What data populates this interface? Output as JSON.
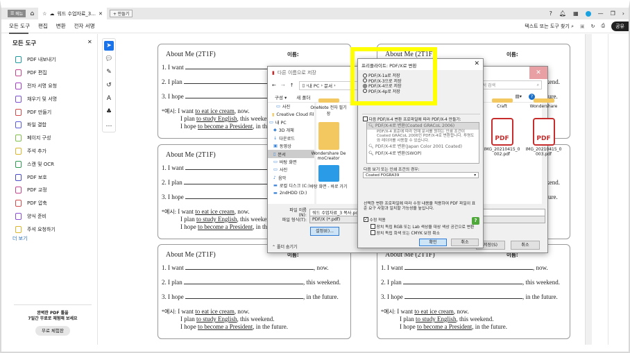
{
  "tabbar": {
    "menu_label": "메뉴",
    "doc_tab": "워드 수업자료_3...",
    "new_tab": "+ 만들기",
    "brand_color": "#1aa1e0"
  },
  "toolbar": {
    "nav": [
      "모든 도구",
      "편집",
      "변환",
      "전자 서명"
    ],
    "search_label": "텍스트 또는 도구 찾기",
    "share_label": "공유"
  },
  "left_panel": {
    "title": "모든 도구",
    "items": [
      {
        "label": "PDF 내보내기",
        "color": "#1f9aa0"
      },
      {
        "label": "PDF 편집",
        "color": "#c2458c"
      },
      {
        "label": "전자 서명 요청",
        "color": "#a13ec1"
      },
      {
        "label": "채우기 및 서명",
        "color": "#7a4fd1"
      },
      {
        "label": "PDF 만들기",
        "color": "#d24b4b"
      },
      {
        "label": "파일 결합",
        "color": "#5a5ad6"
      },
      {
        "label": "페이지 구성",
        "color": "#7fbf4a"
      },
      {
        "label": "주석 추가",
        "color": "#d9b62b"
      },
      {
        "label": "스캔 및 OCR",
        "color": "#2e9a4f"
      },
      {
        "label": "PDF 보호",
        "color": "#4a4ac7"
      },
      {
        "label": "PDF 교정",
        "color": "#c2458c"
      },
      {
        "label": "PDF 압축",
        "color": "#d24b4b"
      },
      {
        "label": "양식 준비",
        "color": "#8a4fd1"
      },
      {
        "label": "주석 요청하기",
        "color": "#d9b62b"
      }
    ],
    "more": "더 보기",
    "promo_line1": "완벽한 PDF 툴을",
    "promo_line2": "7일간 무료로 체험해 보세요",
    "trial_button": "무료 체험판"
  },
  "worksheet": {
    "title": "About Me (2T1F)",
    "name_label": "이름:",
    "lines": [
      {
        "prefix": "1. I want",
        "suffix": ", now."
      },
      {
        "prefix": "2. I plan",
        "suffix": ", this weekend."
      },
      {
        "prefix": "3. I hope",
        "suffix": ", in the future."
      }
    ],
    "example_label": "*예시:",
    "examples": [
      {
        "a": "I want ",
        "u": "to eat ice cream",
        "b": ", now."
      },
      {
        "a": "I plan ",
        "u": "to study English",
        "b": ", this weekend."
      },
      {
        "a": "I hope ",
        "u": "to become a President",
        "b": ", in the future."
      }
    ]
  },
  "save_dialog": {
    "title": "다른 이름으로 저장",
    "path": [
      "내 PC",
      "문서"
    ],
    "search_placeholder": "문서 검색",
    "organize": "구성 ▾",
    "new_folder": "새 폴더",
    "tree": [
      "사진",
      "Creative Cloud Fil",
      "내 PC",
      "3D 개체",
      "다운로드",
      "동영상",
      "문서",
      "바탕 화면",
      "사진",
      "음악",
      "로컬 디스크 (C:)",
      "2ndHDD (D:)"
    ],
    "files": [
      {
        "name": "OneNote 전자 필기장",
        "type": "folder"
      },
      {
        "name": "Wondershare DemoCreator",
        "type": "folder"
      },
      {
        "name": "바탕 화면 - 바로 가기",
        "type": "shortcut"
      },
      {
        "name": "Craft",
        "type": "folder"
      },
      {
        "name": "Wondershare",
        "type": "folder"
      },
      {
        "name": "IMG_20210415_0002.pdf",
        "type": "pdf"
      },
      {
        "name": "IMG_20210415_0003.pdf",
        "type": "pdf"
      }
    ],
    "filename_label": "파일 이름(N):",
    "filename": "워드 수업자료_3 복사.pdf",
    "filetype_label": "파일 형식(T):",
    "filetype": "PDF/X (*.pdf)",
    "settings_button": "설정(E)...",
    "hide_folders": "폴더 숨기기",
    "save_button": "저장(S)",
    "cancel_button": "취소"
  },
  "pdfx_dialog": {
    "title": "프리플라이트: PDF/X로 변환",
    "options": [
      {
        "label": "PDF/X-1a로 저장",
        "selected": false
      },
      {
        "label": "PDF/X-3으로 저장",
        "selected": false
      },
      {
        "label": "PDF/X-4으로 저장",
        "selected": true
      },
      {
        "label": "PDF/X-4p로 저장",
        "selected": false
      }
    ],
    "profile_checkbox": "다음 PDF/X-4 변환 프로파일에 따라 PDF/X-4 만들기:",
    "profiles": [
      {
        "title": "PDF/X-4로 변환(Coated GRACoL 2006)",
        "desc": "PDF/X-4 표준에 따라 현재 문서를 원하는 인쇄 조건이 Coated GRACoL 2006인 PDF/X-4로 변환합니다. 투명도와 레이어를 사용할 수 있습니다."
      },
      {
        "title": "PDF/X-4로 변환(Japan Color 2001 Coated)"
      },
      {
        "title": "PDF/X-4로 변환(SWOP)"
      }
    ],
    "condition_label": "다음 보기 또는 인쇄 조건의 경우:",
    "condition_value": "Coated FOGRA39",
    "info": "선택한 변환 프로파일에 따라 수정 내용을 적용하여 PDF 파일이 표준 요구 사항과 일치할 가능성을 높입니다.",
    "apply_fix": "수정 적용",
    "apply_fix_checked": true,
    "sub_options": [
      "장치 독립 RGB 또는 Lab 색상을 대상 색상 공간으로 변환",
      "장치 독립 회색 또는 CMYK 보정 취소"
    ],
    "ok": "확인",
    "cancel": "취소",
    "highlight_color": "#ffff00"
  }
}
